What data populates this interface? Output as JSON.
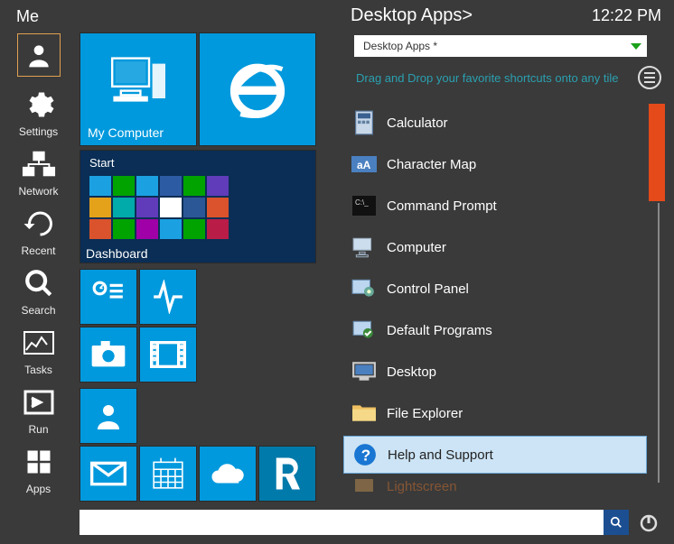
{
  "sidebar": {
    "header": "Me",
    "items": [
      {
        "label": ""
      },
      {
        "label": "Settings"
      },
      {
        "label": "Network"
      },
      {
        "label": "Recent"
      },
      {
        "label": "Search"
      },
      {
        "label": "Tasks"
      },
      {
        "label": "Run"
      },
      {
        "label": "Apps"
      }
    ]
  },
  "tiles": {
    "my_computer": "My Computer",
    "dashboard": "Dashboard",
    "dashboard_start": "Start"
  },
  "right": {
    "title": "Desktop Apps>",
    "time": "12:22 PM",
    "dropdown": "Desktop Apps *",
    "hint": "Drag and Drop your favorite shortcuts onto any tile",
    "apps": [
      {
        "label": "Calculator"
      },
      {
        "label": "Character Map"
      },
      {
        "label": "Command Prompt"
      },
      {
        "label": "Computer"
      },
      {
        "label": "Control Panel"
      },
      {
        "label": "Default Programs"
      },
      {
        "label": "Desktop"
      },
      {
        "label": "File Explorer"
      },
      {
        "label": "Help and Support"
      },
      {
        "label": "Lightscreen"
      }
    ]
  },
  "search": {
    "placeholder": ""
  },
  "colors": {
    "accent": "#0099dd",
    "scroll_thumb": "#e44a1a"
  }
}
